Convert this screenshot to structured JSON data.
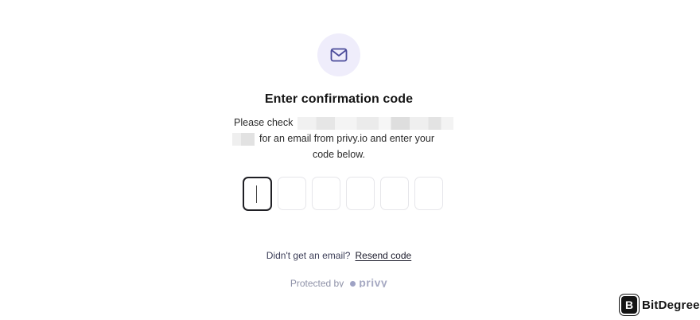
{
  "icons": {
    "mail": "mail-icon",
    "logo_dot": "dot-icon",
    "brand_badge": "bitdegree-badge-icon"
  },
  "colors": {
    "icon_bg": "#efedfb",
    "icon_stroke": "#5b5bb0",
    "active_border": "#1f1f24",
    "muted": "#8f92a8"
  },
  "header": {
    "title": "Enter confirmation code"
  },
  "description": {
    "line1_prefix": "Please check",
    "line2": "for an email from privy.io and enter your",
    "line3": "code below."
  },
  "code_input": {
    "boxes": [
      "",
      "",
      "",
      "",
      "",
      ""
    ],
    "active_index": 0
  },
  "resend": {
    "prompt": "Didn't get an email?",
    "link": "Resend code"
  },
  "footer": {
    "protected_by": "Protected by",
    "brand": "privy"
  },
  "watermark": {
    "badge_letter": "B",
    "name": "BitDegree"
  }
}
